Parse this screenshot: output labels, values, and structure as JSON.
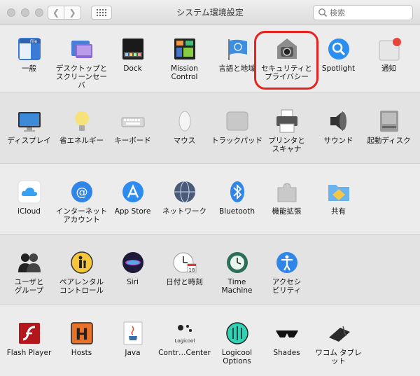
{
  "window": {
    "title": "システム環境設定",
    "search_placeholder": "検索"
  },
  "sections": [
    {
      "name": "personal",
      "items": [
        {
          "label": "一般",
          "icon": "general-icon"
        },
        {
          "label": "デスクトップと\nスクリーンセーバ",
          "icon": "desktop-icon"
        },
        {
          "label": "Dock",
          "icon": "dock-icon"
        },
        {
          "label": "Mission\nControl",
          "icon": "mission-control-icon"
        },
        {
          "label": "言語と地域",
          "icon": "language-region-icon"
        },
        {
          "label": "セキュリティと\nプライバシー",
          "icon": "security-privacy-icon"
        },
        {
          "label": "Spotlight",
          "icon": "spotlight-icon"
        },
        {
          "label": "通知",
          "icon": "notifications-icon"
        }
      ]
    },
    {
      "name": "hardware",
      "items": [
        {
          "label": "ディスプレイ",
          "icon": "display-icon"
        },
        {
          "label": "省エネルギー",
          "icon": "energy-saver-icon"
        },
        {
          "label": "キーボード",
          "icon": "keyboard-icon"
        },
        {
          "label": "マウス",
          "icon": "mouse-icon"
        },
        {
          "label": "トラックパッド",
          "icon": "trackpad-icon"
        },
        {
          "label": "プリンタと\nスキャナ",
          "icon": "printer-icon"
        },
        {
          "label": "サウンド",
          "icon": "sound-icon"
        },
        {
          "label": "起動ディスク",
          "icon": "startup-disk-icon"
        }
      ]
    },
    {
      "name": "internet",
      "items": [
        {
          "label": "iCloud",
          "icon": "icloud-icon"
        },
        {
          "label": "インターネット\nアカウント",
          "icon": "internet-accounts-icon"
        },
        {
          "label": "App Store",
          "icon": "app-store-icon"
        },
        {
          "label": "ネットワーク",
          "icon": "network-icon"
        },
        {
          "label": "Bluetooth",
          "icon": "bluetooth-icon"
        },
        {
          "label": "機能拡張",
          "icon": "extensions-icon"
        },
        {
          "label": "共有",
          "icon": "sharing-icon"
        }
      ]
    },
    {
      "name": "system",
      "items": [
        {
          "label": "ユーザと\nグループ",
          "icon": "users-groups-icon"
        },
        {
          "label": "ペアレンタル\nコントロール",
          "icon": "parental-controls-icon"
        },
        {
          "label": "Siri",
          "icon": "siri-icon"
        },
        {
          "label": "日付と時刻",
          "icon": "date-time-icon"
        },
        {
          "label": "Time\nMachine",
          "icon": "time-machine-icon"
        },
        {
          "label": "アクセシ\nビリティ",
          "icon": "accessibility-icon"
        }
      ]
    },
    {
      "name": "other",
      "items": [
        {
          "label": "Flash Player",
          "icon": "flash-player-icon"
        },
        {
          "label": "Hosts",
          "icon": "hosts-icon"
        },
        {
          "label": "Java",
          "icon": "java-icon"
        },
        {
          "label": "Contr…Center",
          "icon": "logicool-control-center-icon"
        },
        {
          "label": "Logicool Options",
          "icon": "logicool-options-icon"
        },
        {
          "label": "Shades",
          "icon": "shades-icon"
        },
        {
          "label": "ワコム タブレット",
          "icon": "wacom-tablet-icon"
        }
      ]
    }
  ],
  "colors": {
    "highlight": "#e8231e",
    "notification_badge": "#e9443a"
  }
}
